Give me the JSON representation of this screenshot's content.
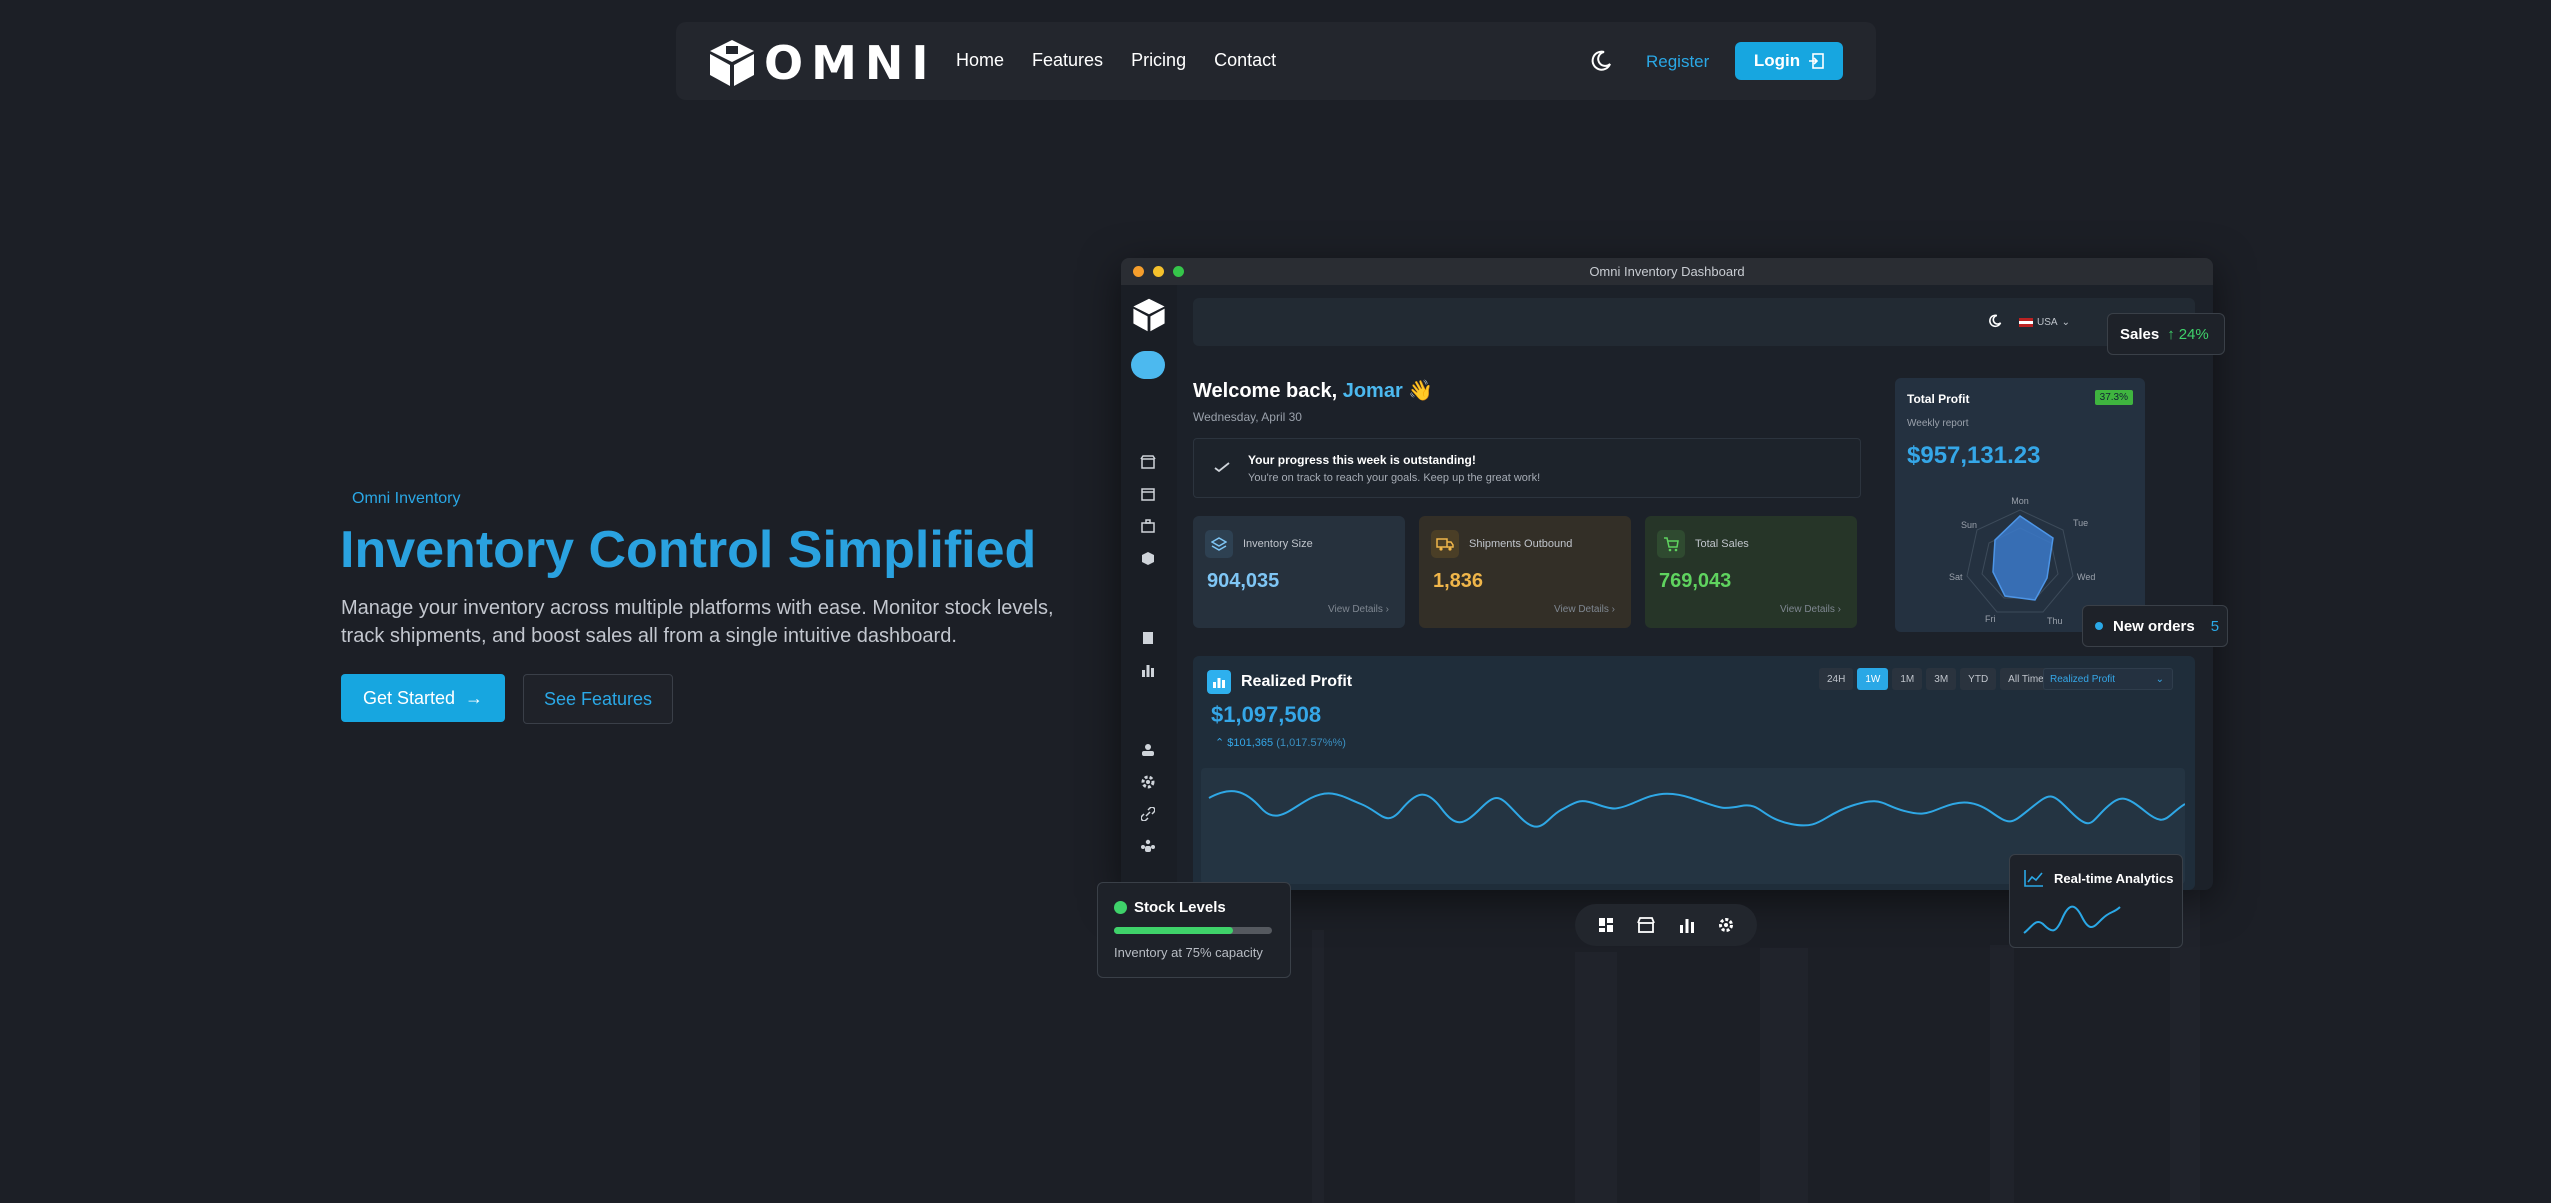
{
  "nav": {
    "logo_text": "OMNI",
    "links": [
      "Home",
      "Features",
      "Pricing",
      "Contact"
    ],
    "register": "Register",
    "login": "Login"
  },
  "hero": {
    "eyebrow": "Omni Inventory",
    "title": "Inventory Control Simplified",
    "description": "Manage your inventory across multiple platforms with ease. Monitor stock levels, track shipments, and boost sales all from a single intuitive dashboard.",
    "primary_button": "Get Started",
    "secondary_button": "See Features"
  },
  "dashboard": {
    "window_title": "Omni Inventory Dashboard",
    "country": "USA",
    "welcome_prefix": "Welcome back,",
    "user_name": "Jomar",
    "wave": "👋",
    "date": "Wednesday, April 30",
    "progress_title": "Your progress this week is outstanding!",
    "progress_sub": "You're on track to reach your goals. Keep up the great work!",
    "stats": [
      {
        "label": "Inventory Size",
        "value": "904,035",
        "link": "View Details",
        "color": "#7fc6f5"
      },
      {
        "label": "Shipments Outbound",
        "value": "1,836",
        "link": "View Details",
        "color": "#f0b64a"
      },
      {
        "label": "Total Sales",
        "value": "769,043",
        "link": "View Details",
        "color": "#5fd35f"
      }
    ],
    "profit_card": {
      "title": "Total Profit",
      "badge": "37.3%",
      "subtitle": "Weekly report",
      "value": "$957,131.23",
      "radar_days": [
        "Mon",
        "Tue",
        "Wed",
        "Thu",
        "Fri",
        "Sat",
        "Sun"
      ]
    },
    "realized_profit": {
      "title": "Realized Profit",
      "value": "$1,097,508",
      "change": "$101,365",
      "change_pct": "(1,017.57%%)",
      "ranges": [
        "24H",
        "1W",
        "1M",
        "3M",
        "YTD",
        "All Time"
      ],
      "active_range": "1W",
      "select": "Realized Profit"
    }
  },
  "floating": {
    "sales_label": "Sales",
    "sales_change": "24%",
    "new_orders_label": "New orders",
    "new_orders_count": "5",
    "stock_title": "Stock Levels",
    "stock_sub": "Inventory at 75% capacity",
    "stock_level": 0.75,
    "analytics_title": "Real-time Analytics"
  },
  "colors": {
    "accent": "#17a6e0",
    "background": "#1c1f26",
    "success": "#3fd26a"
  }
}
